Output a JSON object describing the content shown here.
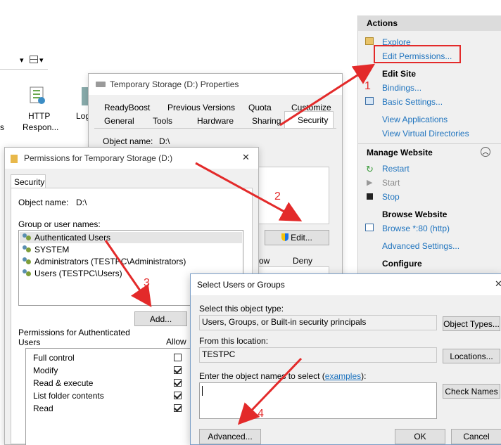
{
  "iis": {
    "toolbar": {
      "dropdown_glyph": "▾"
    },
    "icon_labels": [
      "HTTP",
      "Respon...",
      "Log",
      "s"
    ]
  },
  "actions": {
    "title": "Actions",
    "items1": [
      "Explore",
      "Edit Permissions..."
    ],
    "edit_site_title": "Edit Site",
    "items2": [
      "Bindings...",
      "Basic Settings...",
      "View Applications",
      "View Virtual Directories"
    ],
    "manage_title": "Manage Website",
    "manage_items": [
      "Restart",
      "Start",
      "Stop"
    ],
    "browse_title": "Browse Website",
    "browse_item": "Browse *:80 (http)",
    "advanced": "Advanced Settings...",
    "configure": "Configure"
  },
  "properties": {
    "title": "Temporary Storage (D:) Properties",
    "tabs_row1": [
      "ReadyBoost",
      "Previous Versions",
      "Quota",
      "Customize"
    ],
    "tabs_row2": [
      "General",
      "Tools",
      "Hardware",
      "Sharing",
      "Security"
    ],
    "object_name_label": "Object name:",
    "object_name_value": "D:\\",
    "edit_button": "Edit...",
    "allow_header": "ow",
    "deny_header": "Deny"
  },
  "permissions": {
    "title": "Permissions for Temporary Storage (D:)",
    "tab": "Security",
    "object_name_label": "Object name:",
    "object_name_value": "D:\\",
    "group_label": "Group or user names:",
    "users": [
      "Authenticated Users",
      "SYSTEM",
      "Administrators (TESTPC\\Administrators)",
      "Users (TESTPC\\Users)"
    ],
    "add_button": "Add...",
    "perm_label_1": "Permissions for Authenticated",
    "perm_label_2": "Users",
    "allow_col": "Allow",
    "perm_rows": [
      {
        "name": "Full control",
        "allow": false
      },
      {
        "name": "Modify",
        "allow": true
      },
      {
        "name": "Read & execute",
        "allow": true
      },
      {
        "name": "List folder contents",
        "allow": true
      },
      {
        "name": "Read",
        "allow": true
      }
    ]
  },
  "select_users": {
    "title": "Select Users or Groups",
    "close_glyph": "✕",
    "obj_type_label": "Select this object type:",
    "obj_type_value": "Users, Groups, or Built-in security principals",
    "obj_types_button": "Object Types...",
    "location_label": "From this location:",
    "location_value": "TESTPC",
    "locations_button": "Locations...",
    "names_label_pre": "Enter the object names to select (",
    "names_label_link": "examples",
    "names_label_post": "):",
    "check_names_button": "Check Names",
    "advanced_button": "Advanced...",
    "ok_button": "OK",
    "cancel_button": "Cancel"
  },
  "annotations": {
    "step1": "1",
    "step2": "2",
    "step3": "3",
    "step4": "4",
    "color": "#e32a2a"
  }
}
